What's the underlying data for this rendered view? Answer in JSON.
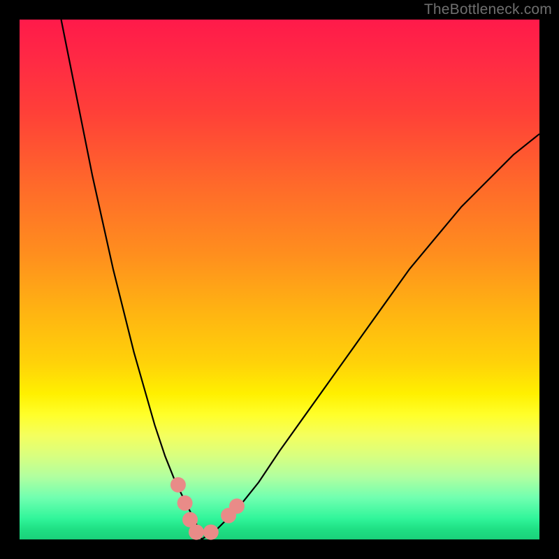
{
  "watermark": "TheBottleneck.com",
  "chart_data": {
    "type": "line",
    "title": "",
    "xlabel": "",
    "ylabel": "",
    "xlim": [
      0,
      100
    ],
    "ylim": [
      0,
      100
    ],
    "grid": false,
    "series": [
      {
        "name": "bottleneck-curve",
        "x": [
          8,
          10,
          12,
          14,
          16,
          18,
          20,
          22,
          24,
          26,
          28,
          30,
          32,
          34,
          35,
          38,
          42,
          46,
          50,
          55,
          60,
          65,
          70,
          75,
          80,
          85,
          90,
          95,
          100
        ],
        "values": [
          100,
          90,
          80,
          70,
          61,
          52,
          44,
          36,
          29,
          22,
          16,
          11,
          7,
          3,
          0,
          2,
          6,
          11,
          17,
          24,
          31,
          38,
          45,
          52,
          58,
          64,
          69,
          74,
          78
        ]
      }
    ],
    "markers": {
      "name": "highlight-dots",
      "points": [
        {
          "x": 30.5,
          "y": 10.5
        },
        {
          "x": 31.8,
          "y": 7.0
        },
        {
          "x": 32.8,
          "y": 3.8
        },
        {
          "x": 34.0,
          "y": 1.4
        },
        {
          "x": 36.8,
          "y": 1.4
        },
        {
          "x": 40.2,
          "y": 4.6
        },
        {
          "x": 41.8,
          "y": 6.4
        }
      ]
    },
    "colors": {
      "curve": "#000000",
      "markers": "#e98b88",
      "gradient_top": "#ff1a4a",
      "gradient_bottom": "#1ad07a"
    }
  }
}
